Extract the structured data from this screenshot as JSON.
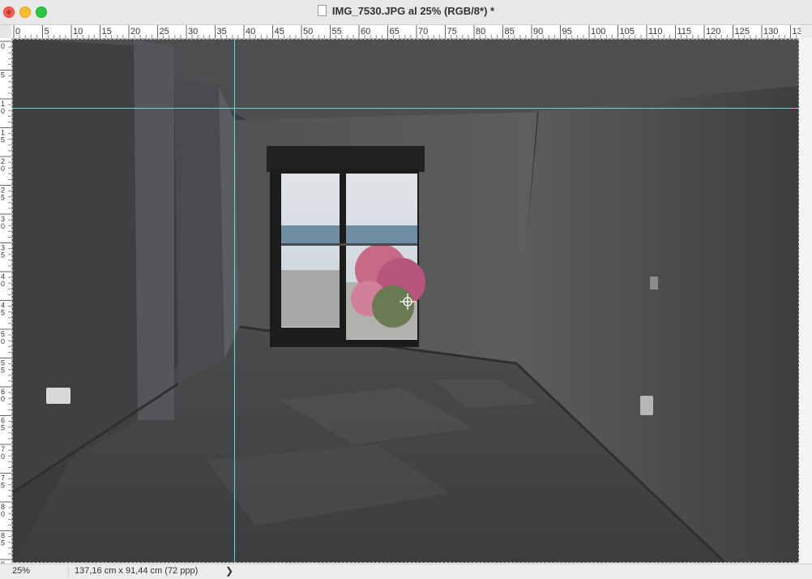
{
  "window": {
    "title": "IMG_7530.JPG al 25% (RGB/8*) *"
  },
  "ruler_top": {
    "labels": [
      "0",
      "5",
      "10",
      "15",
      "20",
      "25",
      "30",
      "35",
      "40",
      "45",
      "50",
      "55",
      "60",
      "65",
      "70",
      "75",
      "80",
      "85",
      "90",
      "95",
      "100",
      "105",
      "110",
      "115",
      "120",
      "125",
      "130",
      "13"
    ]
  },
  "ruler_left": {
    "labels": [
      "0",
      "5",
      "1\n0",
      "1\n5",
      "2\n0",
      "2\n5",
      "3\n0",
      "3\n5",
      "4\n0",
      "4\n5",
      "5\n0",
      "5\n5",
      "6\n0",
      "6\n5",
      "7\n0",
      "7\n5",
      "8\n0",
      "8\n5",
      "9"
    ]
  },
  "status": {
    "zoom": "25%",
    "doc_info": "137,16 cm x 91,44 cm (72 ppp)",
    "arrow": "❯"
  },
  "icons": {
    "doc": "document-icon",
    "cursor": "crosshair-move-icon"
  },
  "colors": {
    "guide": "#6ed3da",
    "close": "#fe5f57",
    "minimize": "#febc2e",
    "maximize": "#28c840"
  }
}
